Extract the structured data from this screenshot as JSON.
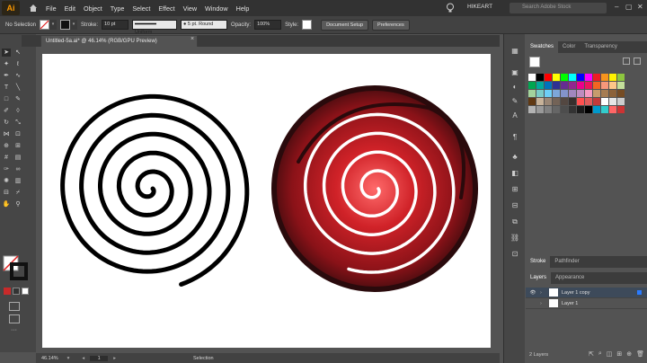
{
  "app": {
    "logo": "Ai",
    "workspace": "HIKEART",
    "search_placeholder": "Search Adobe Stock"
  },
  "menu": [
    "File",
    "Edit",
    "Object",
    "Type",
    "Select",
    "Effect",
    "View",
    "Window",
    "Help"
  ],
  "control_bar": {
    "selection": "No Selection",
    "stroke_label": "Stroke:",
    "stroke_weight": "10 pt",
    "profile": "Uniform",
    "brush": "5 pt. Round",
    "opacity_label": "Opacity:",
    "opacity": "100%",
    "style_label": "Style:",
    "doc_setup": "Document Setup",
    "preferences": "Preferences"
  },
  "document": {
    "tab_title": "Untitled-5a.ai* @ 46.14% (RGB/GPU Preview)",
    "close": "×"
  },
  "status": {
    "zoom": "46.14%",
    "page": "1",
    "mode": "Selection"
  },
  "panels": {
    "top_tabs": [
      "Swatches",
      "Color",
      "Transparency"
    ],
    "stroke_tabs": [
      "Stroke",
      "Pathfinder"
    ],
    "layer_tabs": [
      "Layers",
      "Appearance"
    ],
    "layers": [
      "Layer 1 copy",
      "Layer 1"
    ],
    "layers_count": "2 Layers"
  },
  "colors": {
    "accent": "#ff9a00",
    "spiral_red": "#c8202a",
    "spiral_dark": "#3a0a0e"
  },
  "icons": [
    "home-icon",
    "bulb-icon",
    "search-icon",
    "minimize-icon",
    "maximize-icon",
    "close-icon"
  ]
}
